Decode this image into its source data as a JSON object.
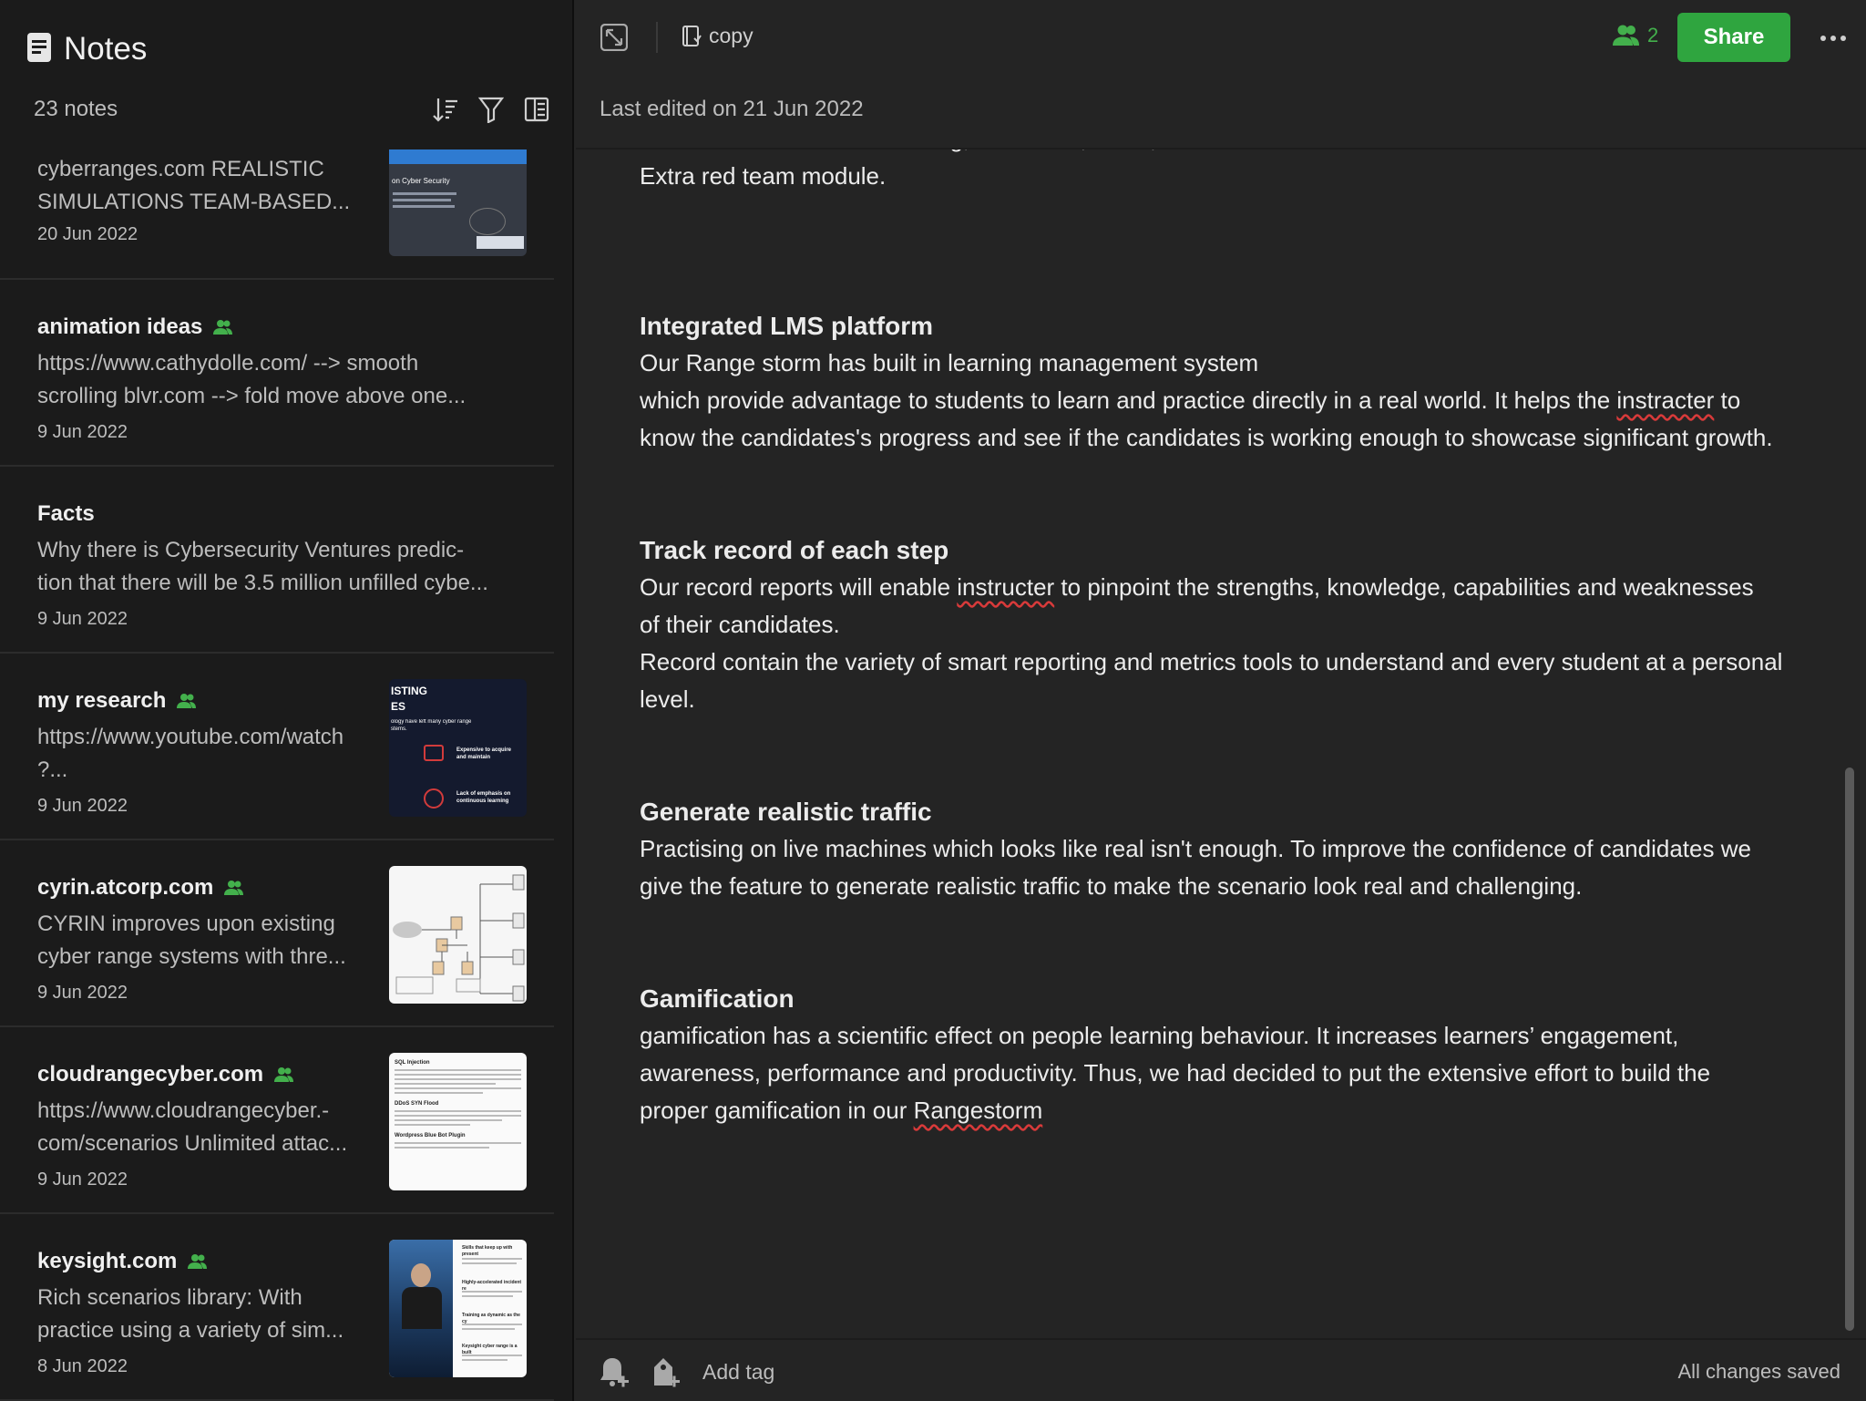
{
  "sidebar": {
    "title": "Notes",
    "count": "23 notes",
    "notes": [
      {
        "title": "",
        "snippet": "cyberranges.com REALISTIC\nSIMULATIONS TEAM-BASED...",
        "date": "20 Jun 2022",
        "shared": false,
        "thumb": "cyber-security-slide"
      },
      {
        "title": "animation ideas",
        "snippet": "https://www.cathydolle.com/ --> smooth\nscrolling blvr.com --> fold move above one...",
        "date": "9 Jun 2022",
        "shared": true,
        "thumb": ""
      },
      {
        "title": "Facts",
        "snippet": "Why there is Cybersecurity Ventures predic-\ntion that there will be 3.5 million unfilled cybe...",
        "date": "9 Jun 2022",
        "shared": false,
        "thumb": ""
      },
      {
        "title": "my research",
        "snippet": "https://www.youtube.com/watch\n?...",
        "date": "9 Jun 2022",
        "shared": true,
        "thumb": "existing-issues-slide"
      },
      {
        "title": "cyrin.atcorp.com",
        "snippet": "CYRIN improves upon existing\ncyber range systems with thre...",
        "date": "9 Jun 2022",
        "shared": true,
        "thumb": "network-diagram"
      },
      {
        "title": "cloudrangecyber.com",
        "snippet": "https://www.cloudrangecyber.-\ncom/scenarios Unlimited attac...",
        "date": "9 Jun 2022",
        "shared": true,
        "thumb": "document-page"
      },
      {
        "title": "keysight.com",
        "snippet": "Rich scenarios library: With\npractice using a variety of sim...",
        "date": "8 Jun 2022",
        "shared": true,
        "thumb": "photo-document"
      }
    ],
    "thumb_text": {
      "cyber": "on Cyber Security",
      "issues_1": "ISTING",
      "issues_2": "ES",
      "issues_3": "ology have left many cyber range",
      "issues_4": "stems.",
      "issues_5": "Expensive to acquire and maintain",
      "issues_6": "Lack of emphasis on continuous learning",
      "doc_1": "SQL Injection",
      "doc_2": "DDoS SYN Flood",
      "doc_3": "Wordpress Blue Bot Plugin",
      "key_1": "Skills that keep up with present",
      "key_2": "Highly-accelerated incident re",
      "key_3": "Training as dynamic as the cy",
      "key_4": "Keysight cyber range is a built"
    }
  },
  "topbar": {
    "notebook": "copy",
    "collaborators": "2",
    "share_label": "Share",
    "last_edited": "Last edited on 21 Jun 2022"
  },
  "content": {
    "cut_top": "Generate realistic traffic for e.g; Facebook, email, etc",
    "line_0": "Extra red team module.",
    "h1": "Integrated LMS platform",
    "p1_a": "Our Range storm has built in learning management system",
    "p1_b1": "which provide advantage to students to learn and practice directly in a real world. It helps the ",
    "p1_b_err": "instracter",
    "p1_b2": " to",
    "p1_c": "know the candidates's progress and see if the candidates is working enough to showcase significant growth.",
    "h2": "Track record of each step",
    "p2_a1": "Our record reports will enable ",
    "p2_a_err": "instructer",
    "p2_a2": " to pinpoint the strengths, knowledge, capabilities and weaknesses",
    "p2_b": "of their candidates.",
    "p2_c": "Record contain the variety of smart reporting and metrics tools to understand and every student at a personal",
    "p2_d": "level.",
    "h3": "Generate realistic traffic",
    "p3_a": "Practising on live machines which looks like real isn't enough. To improve the confidence of candidates we",
    "p3_b": "give the feature to generate realistic traffic to make the scenario look real and challenging.",
    "h4": "Gamification",
    "p4_a": "gamification has a scientific effect on people learning behaviour. It increases learners’ engagement,",
    "p4_b": "awareness, performance and productivity. Thus, we had decided to put the extensive effort to build the",
    "p4_c1": "proper gamification in our ",
    "p4_c_err": "Rangestorm"
  },
  "footer": {
    "add_tag": "Add tag",
    "status": "All changes saved"
  },
  "colors": {
    "accent": "#2fa53f",
    "shared_icon": "#43b04c",
    "sidebar_bg": "#1b1b1b",
    "editor_bg": "#242424"
  }
}
